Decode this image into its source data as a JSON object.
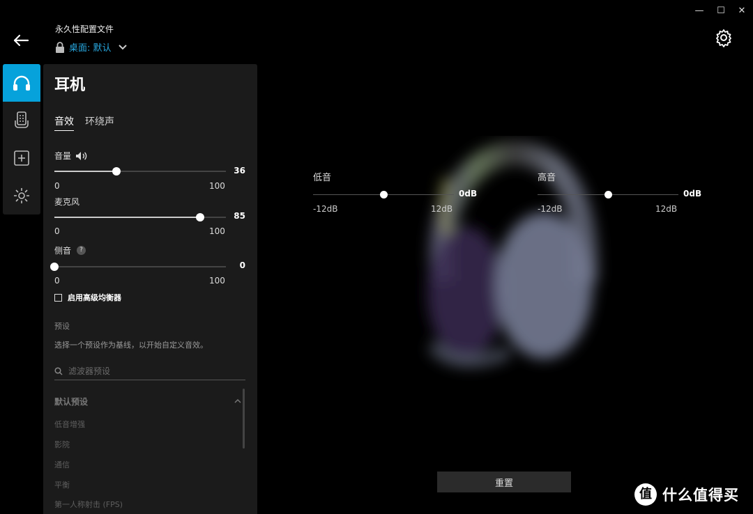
{
  "window": {
    "minimize_glyph": "—",
    "maximize_glyph": "☐",
    "close_glyph": "✕"
  },
  "header": {
    "profile_title": "永久性配置文件",
    "profile_selected": "桌面: 默认"
  },
  "rail": {
    "items": [
      "headphones-icon",
      "device-remote-icon",
      "add-icon",
      "lighting-icon"
    ],
    "accent": "#06a2db"
  },
  "panel": {
    "title": "耳机",
    "tabs": [
      "音效",
      "环绕声"
    ],
    "active_tab": 0,
    "sliders": [
      {
        "label": "音量",
        "value": "36",
        "level": 0.36,
        "min": "0",
        "max": "100"
      },
      {
        "label": "麦克风",
        "value": "85",
        "level": 0.85,
        "min": "0",
        "max": "100"
      },
      {
        "label": "侧音",
        "value": "0",
        "level": 0.0,
        "min": "0",
        "max": "100"
      }
    ],
    "sidetone_help": "?",
    "advanced_eq_label": "启用高级均衡器",
    "preset_heading": "预设",
    "preset_desc": "选择一个预设作为基线，以开始自定义音效。",
    "search_placeholder": "滤波器预设",
    "group_title": "默认预设",
    "presets": [
      "低音增强",
      "影院",
      "通信",
      "平衡",
      "第一人称射击 (FPS)"
    ]
  },
  "eq": {
    "bass": {
      "label": "低音",
      "value": "0dB",
      "min": "-12dB",
      "max": "12dB",
      "level": 0.5
    },
    "treble": {
      "label": "高音",
      "value": "0dB",
      "min": "-12dB",
      "max": "12dB",
      "level": 0.5
    }
  },
  "reset_label": "重置",
  "watermark": "什么值得买"
}
